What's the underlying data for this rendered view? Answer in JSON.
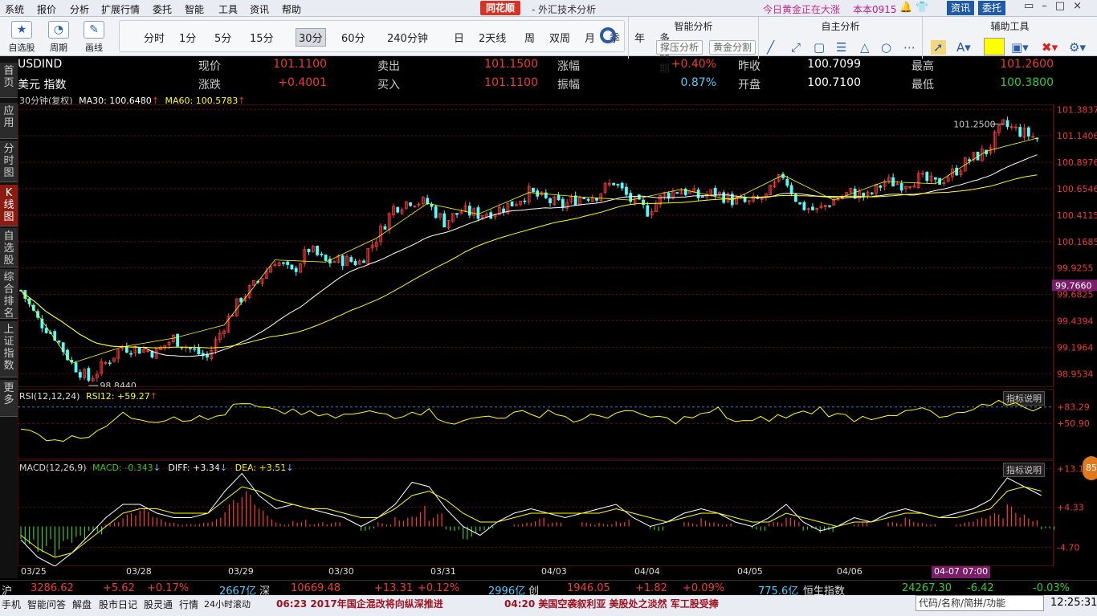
{
  "menu": [
    "系统",
    "报价",
    "分析",
    "扩展行情",
    "委托",
    "智能",
    "工具",
    "资讯",
    "帮助"
  ],
  "brand": "同花顺",
  "subtitle": "- 外汇技术分析",
  "marquee": "今日黄金正在大涨",
  "benben": "本本0915",
  "top_buttons": {
    "zixun": "资讯",
    "weituo": "委托"
  },
  "toolbar": {
    "items": [
      {
        "label": "自选股",
        "icon": "star-icon"
      },
      {
        "label": "周期",
        "icon": "cycle-icon"
      },
      {
        "label": "画线",
        "icon": "pen-icon"
      }
    ],
    "periods": [
      "分时",
      "1分",
      "5分",
      "15分",
      "30分",
      "60分",
      "240分钟",
      "日",
      "2天线",
      "周",
      "双周",
      "月",
      "季",
      "年",
      "多周期"
    ],
    "active_period": "30分"
  },
  "panels": {
    "smart": {
      "title": "智能分析",
      "buttons": [
        "撑压分析",
        "黄金分割"
      ]
    },
    "own": {
      "title": "自主分析"
    },
    "aux": {
      "title": "辅助工具"
    }
  },
  "side_nav": [
    "首页",
    "应用",
    "分时图",
    "K线图",
    "自选股",
    "综合排名",
    "上证指数",
    "更多"
  ],
  "quote": {
    "code": "USDIND",
    "name": "美元 指数",
    "l1": [
      "现价",
      "101.1100",
      "卖出",
      "101.1500",
      "涨幅",
      "+0.40%",
      "昨收",
      "100.7099",
      "最高",
      "101.2600"
    ],
    "l2": [
      "涨跌",
      "+0.4001",
      "买入",
      "101.1100",
      "振幅",
      "0.87%",
      "开盘",
      "100.7100",
      "最低",
      "100.3800"
    ]
  },
  "ma_legend": {
    "title": "30分钟(复权)",
    "ma30": "MA30: 100.6480",
    "ma60": "MA60: 100.5783"
  },
  "rsi_legend": {
    "name": "RSI(12,12,24)",
    "val": "RSI12: +59.27"
  },
  "macd_legend": {
    "name": "MACD(12,26,9)",
    "macd": "MACD: -0.343",
    "diff": "DIFF: +3.34",
    "dea": "DEA: +3.51"
  },
  "indicator_help": "指标说明",
  "chart_data": {
    "type": "candlestick",
    "interval": "30分钟",
    "y_ticks": [
      "101.3837",
      "101.1406",
      "100.8976",
      "100.6546",
      "100.4115",
      "100.1685",
      "99.9255",
      "99.6825",
      "99.4394",
      "99.1964",
      "98.9534"
    ],
    "y_highlight": "99.7660",
    "ylim": [
      98.83,
      101.43
    ],
    "annotations": {
      "high": "101.2500",
      "low": "98.8440"
    },
    "x_labels": [
      "03/25",
      "03/28",
      "03/29",
      "03/30",
      "03/31",
      "04/03",
      "04/04",
      "04/05",
      "04/06"
    ],
    "x_highlight": "04-07 07:00",
    "close_path": [
      99.72,
      99.45,
      99.3,
      99.05,
      98.9,
      99.05,
      99.2,
      99.18,
      99.15,
      99.28,
      99.18,
      99.1,
      99.4,
      99.65,
      99.8,
      100.0,
      99.88,
      100.1,
      99.98,
      100.0,
      99.98,
      100.2,
      100.48,
      100.55,
      100.52,
      100.35,
      100.45,
      100.42,
      100.45,
      100.52,
      100.62,
      100.55,
      100.5,
      100.58,
      100.6,
      100.72,
      100.55,
      100.45,
      100.6,
      100.65,
      100.58,
      100.62,
      100.55,
      100.52,
      100.58,
      100.78,
      100.5,
      100.45,
      100.55,
      100.62,
      100.58,
      100.72,
      100.7,
      100.75,
      100.7,
      100.8,
      100.92,
      101.0,
      101.24,
      101.18,
      101.12
    ],
    "rsi": {
      "levels": [
        "+83.29",
        "+50.90"
      ],
      "series": [
        42,
        35,
        30,
        30,
        36,
        50,
        62,
        60,
        56,
        62,
        58,
        56,
        66,
        78,
        72,
        66,
        70,
        64,
        60,
        62,
        64,
        66,
        62,
        70,
        68,
        56,
        52,
        60,
        62,
        64,
        62,
        70,
        60,
        54,
        62,
        66,
        64,
        60,
        56,
        58,
        62,
        70,
        54,
        52,
        58,
        60,
        66,
        72,
        62,
        58,
        60,
        66,
        64,
        72,
        58,
        62,
        70,
        74,
        80,
        76,
        72
      ]
    },
    "macd": {
      "levels": [
        "+13.13",
        "+4.33",
        "-4.70"
      ],
      "hist": [
        -4,
        -6,
        -7,
        -5,
        -2,
        1,
        3,
        4,
        2,
        1,
        1,
        2,
        6,
        8,
        4,
        1,
        2,
        1,
        1,
        0,
        -1,
        1,
        3,
        5,
        3,
        -1,
        -3,
        -1,
        0,
        1,
        2,
        1,
        0,
        1,
        1,
        2,
        0,
        -1,
        0,
        1,
        2,
        1,
        0,
        -1,
        1,
        2,
        -1,
        -2,
        0,
        1,
        0,
        1,
        2,
        1,
        0,
        1,
        2,
        3,
        5,
        3,
        -1
      ],
      "diff": [
        -3,
        -7,
        -9,
        -6,
        -2,
        2,
        5,
        5,
        3,
        2,
        2,
        3,
        8,
        12,
        7,
        4,
        5,
        4,
        3,
        2,
        0,
        2,
        5,
        10,
        9,
        4,
        0,
        -2,
        1,
        3,
        4,
        3,
        2,
        3,
        4,
        5,
        2,
        0,
        1,
        3,
        4,
        3,
        1,
        0,
        2,
        5,
        1,
        -1,
        0,
        2,
        1,
        3,
        4,
        3,
        2,
        3,
        4,
        6,
        11,
        9,
        7
      ],
      "dea": [
        -2,
        -5,
        -7,
        -6,
        -3,
        0,
        3,
        4,
        4,
        3,
        3,
        3,
        6,
        9,
        8,
        6,
        5,
        4,
        4,
        3,
        2,
        2,
        4,
        7,
        8,
        6,
        3,
        1,
        1,
        2,
        3,
        3,
        3,
        3,
        3,
        4,
        3,
        2,
        1,
        2,
        3,
        3,
        2,
        1,
        1,
        3,
        2,
        1,
        0,
        1,
        1,
        2,
        3,
        3,
        2,
        2,
        3,
        4,
        8,
        9,
        8
      ]
    }
  },
  "ticker": {
    "sh": "沪",
    "sh_val": "3286.62",
    "sh_chg": "+5.62",
    "sh_pct": "+0.17%",
    "sh_amt": "2667亿",
    "sz": "深",
    "sz_val": "10669.48",
    "sz_chg": "+13.31",
    "sz_pct": "+0.12%",
    "sz_amt": "2996亿",
    "cy": "创",
    "cy_val": "1946.05",
    "cy_chg": "+1.82",
    "cy_pct": "+0.09%",
    "cy_amt": "775.6亿",
    "hs": "恒生指数",
    "hs_val": "24267.30",
    "hs_chg": "-6.42",
    "hs_pct": "-0.03%"
  },
  "status": {
    "items": [
      "手机",
      "智能问答",
      "解盘",
      "股市日记",
      "股灵通",
      "行情",
      "24小时滚动"
    ],
    "news1": "06:23 2017年国企混改将向纵深推进",
    "news2": "04:20 美国空袭叙利亚 美股处之淡然 军工股受捧",
    "search_placeholder": "代码/名称/简拼/功能",
    "time": "12:25:31"
  },
  "badge": "85"
}
